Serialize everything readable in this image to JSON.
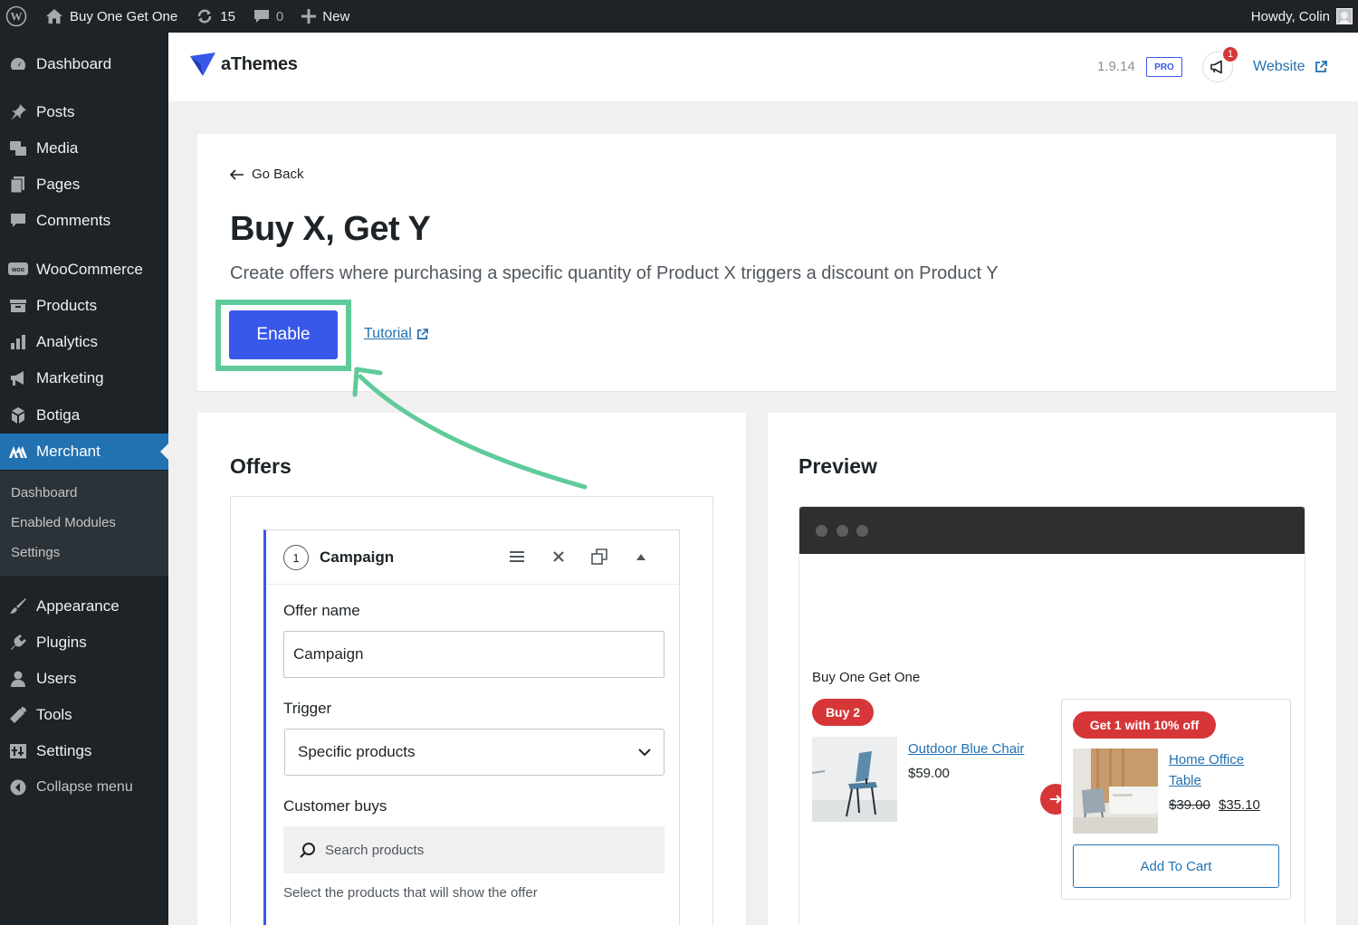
{
  "adminbar": {
    "site_name": "Buy One Get One",
    "updates_count": "15",
    "comments_count": "0",
    "new_label": "New",
    "howdy": "Howdy, Colin"
  },
  "sidebar": {
    "items": [
      {
        "label": "Dashboard",
        "icon": "dashboard-icon"
      },
      {
        "label": "Posts",
        "icon": "pin-icon"
      },
      {
        "label": "Media",
        "icon": "media-icon"
      },
      {
        "label": "Pages",
        "icon": "pages-icon"
      },
      {
        "label": "Comments",
        "icon": "comment-icon"
      },
      {
        "label": "WooCommerce",
        "icon": "woo-icon"
      },
      {
        "label": "Products",
        "icon": "archive-icon"
      },
      {
        "label": "Analytics",
        "icon": "bar-chart-icon"
      },
      {
        "label": "Marketing",
        "icon": "megaphone-icon"
      },
      {
        "label": "Botiga",
        "icon": "botiga-icon"
      },
      {
        "label": "Merchant",
        "icon": "merchant-icon"
      },
      {
        "label": "Appearance",
        "icon": "brush-icon"
      },
      {
        "label": "Plugins",
        "icon": "plugin-icon"
      },
      {
        "label": "Users",
        "icon": "user-icon"
      },
      {
        "label": "Tools",
        "icon": "wrench-icon"
      },
      {
        "label": "Settings",
        "icon": "settings-icon"
      }
    ],
    "current": "Merchant",
    "submenu": [
      "Dashboard",
      "Enabled Modules",
      "Settings"
    ],
    "collapse_label": "Collapse menu"
  },
  "header": {
    "brand": "aThemes",
    "version": "1.9.14",
    "pro_badge": "PRO",
    "notification_count": "1",
    "website_label": "Website"
  },
  "module": {
    "go_back": "Go Back",
    "title": "Buy X, Get Y",
    "description": "Create offers where purchasing a specific quantity of Product X triggers a discount on Product Y",
    "enable_label": "Enable",
    "tutorial_label": "Tutorial"
  },
  "offers": {
    "section_title": "Offers",
    "campaign_number": "1",
    "campaign_label": "Campaign",
    "offer_name_label": "Offer name",
    "offer_name_value": "Campaign",
    "trigger_label": "Trigger",
    "trigger_value": "Specific products",
    "customer_buys_label": "Customer buys",
    "search_placeholder": "Search products",
    "help_text": "Select the products that will show the offer"
  },
  "preview": {
    "section_title": "Preview",
    "heading": "Buy One Get One",
    "buy_badge": "Buy 2",
    "product_x_name": "Outdoor Blue Chair",
    "product_x_price": "$59.00",
    "offer_badge": "Get 1 with 10% off",
    "product_y_name_line1": "Home Office",
    "product_y_name_line2": "Table",
    "product_y_old_price": "$39.00",
    "product_y_new_price": "$35.10",
    "add_to_cart": "Add To Cart"
  },
  "colors": {
    "accent": "#3858e9",
    "wp_blue": "#2271b1",
    "highlight": "#5fcb9b",
    "badge_red": "#d63638",
    "admin_dark": "#1d2327"
  }
}
